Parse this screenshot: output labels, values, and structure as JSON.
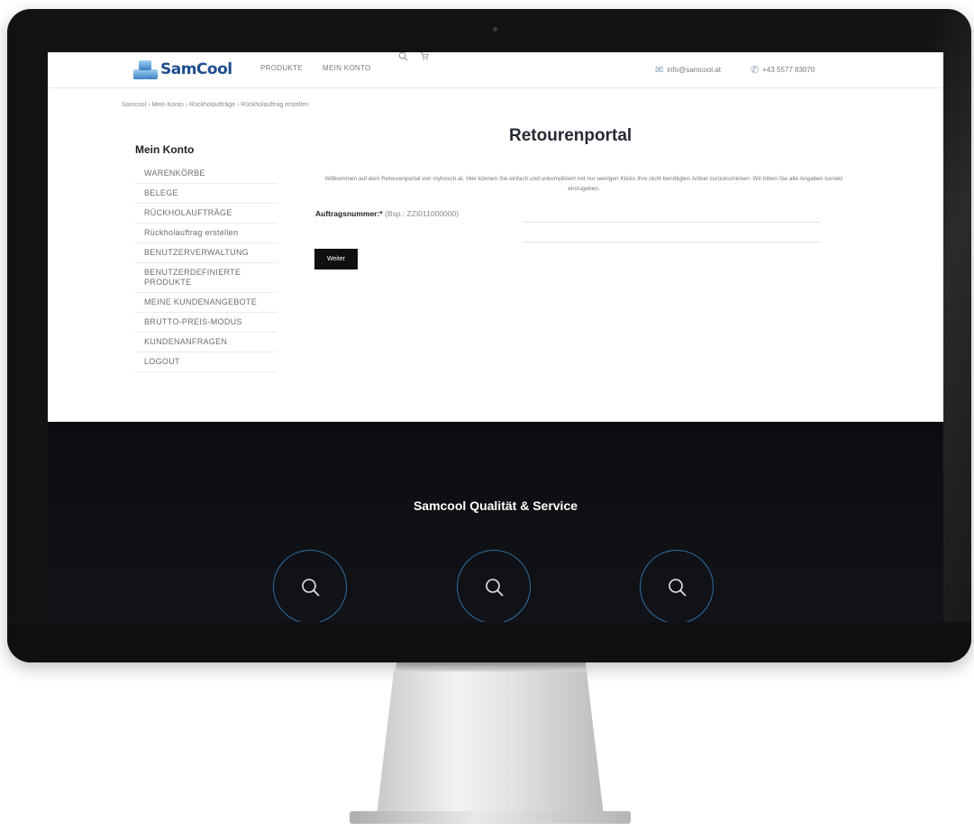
{
  "header": {
    "logo_text": "SamCool",
    "nav": [
      "PRODUKTE",
      "MEIN KONTO"
    ],
    "email": "info@samcool.at",
    "phone": "+43 5577 83070"
  },
  "breadcrumb": "Samcool › Mein Konto › Rückholaufträge › Rückholauftrag erstellen",
  "sidebar": {
    "title": "Mein Konto",
    "items": [
      "WARENKÖRBE",
      "BELEGE",
      "RÜCKHOLAUFTRÄGE",
      "Rückholauftrag erstellen",
      "BENUTZERVERWALTUNG",
      "BENUTZERDEFINIERTE PRODUKTE",
      "MEINE KUNDENANGEBOTE",
      "BRUTTO-PREIS-MODUS",
      "KUNDENANFRAGEN",
      "LOGOUT"
    ]
  },
  "main": {
    "title": "Retourenportal",
    "intro": "Willkommen auf dem Retourenportal von mybosch.at. Hier können Sie einfach und unkompliziert mit nur wenigen Klicks Ihre nicht benötigten Artikel zurückschicken. Wir bitten Sie alle Angaben korrekt einzugeben.",
    "field_label": "Auftragsnummer:*",
    "field_example": "(Bsp.: ZZI011000000)",
    "submit_label": "Weiter"
  },
  "footer": {
    "title": "Samcool Qualität & Service"
  },
  "icons": {
    "search": "search-icon",
    "cart": "cart-icon",
    "email": "envelope-icon",
    "phone": "phone-icon"
  },
  "colors": {
    "brand": "#1e4c8f",
    "accent_ring": "#2f6fa5",
    "button": "#101010",
    "footer_bg": "#0c0d10"
  }
}
